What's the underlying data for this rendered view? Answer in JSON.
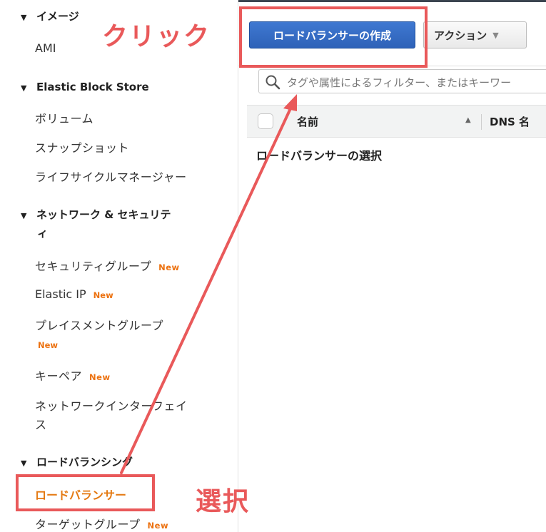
{
  "sidebar": {
    "images_heading": "イメージ",
    "ami": "AMI",
    "ebs_heading": "Elastic Block Store",
    "volumes": "ボリューム",
    "snapshots": "スナップショット",
    "lifecycle": "ライフサイクルマネージャー",
    "network_heading_line1": "ネットワーク & セキュリテ",
    "network_heading_line2": "ィ",
    "security_groups": "セキュリティグループ",
    "elastic_ip": "Elastic IP",
    "placement_groups": "プレイスメントグループ",
    "key_pairs": "キーペア",
    "network_interfaces_line1": "ネットワークインターフェイ",
    "network_interfaces_line2": "ス",
    "lb_heading": "ロードバランシング",
    "load_balancers": "ロードバランサー",
    "target_groups": "ターゲットグループ",
    "new_badge": "New"
  },
  "toolbar": {
    "create_lb": "ロードバランサーの作成",
    "actions": "アクション"
  },
  "filter": {
    "placeholder": "タグや属性によるフィルター、またはキーワー"
  },
  "table": {
    "col_name": "名前",
    "col_dns": "DNS 名",
    "sort_indicator": "▲",
    "select_message": "ロードバランサーの選択"
  },
  "annotations": {
    "click_label": "クリック",
    "select_label": "選択",
    "color": "#e9595a"
  },
  "icons": {
    "triangle": "▼",
    "chevron": "▼"
  }
}
